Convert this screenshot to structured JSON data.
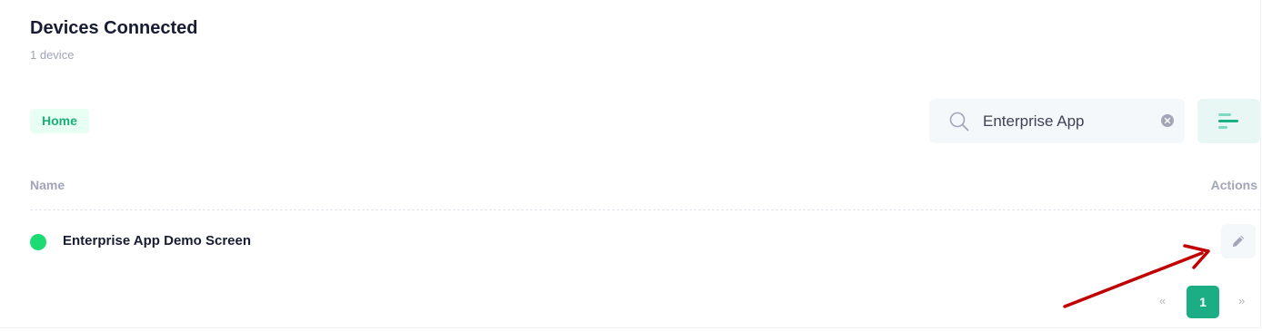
{
  "header": {
    "title": "Devices Connected",
    "subtitle": "1 device"
  },
  "filters": {
    "active_chip": "Home"
  },
  "search": {
    "value": "Enterprise App",
    "icon": "search-icon",
    "clear_icon": "clear-icon"
  },
  "filter_button": {
    "icon": "filter-lines-icon"
  },
  "table": {
    "columns": [
      "Name",
      "Actions"
    ],
    "rows": [
      {
        "name": "Enterprise App Demo Screen",
        "status": "online",
        "status_color": "#1ddb73",
        "action_icon": "pencil-icon"
      }
    ]
  },
  "pagination": {
    "prev": "«",
    "current": "1",
    "next": "»"
  },
  "colors": {
    "accent": "#1bae85",
    "chip_bg": "#e8fff3",
    "chip_text": "#1bb07a",
    "annotation_arrow": "#c00000"
  }
}
